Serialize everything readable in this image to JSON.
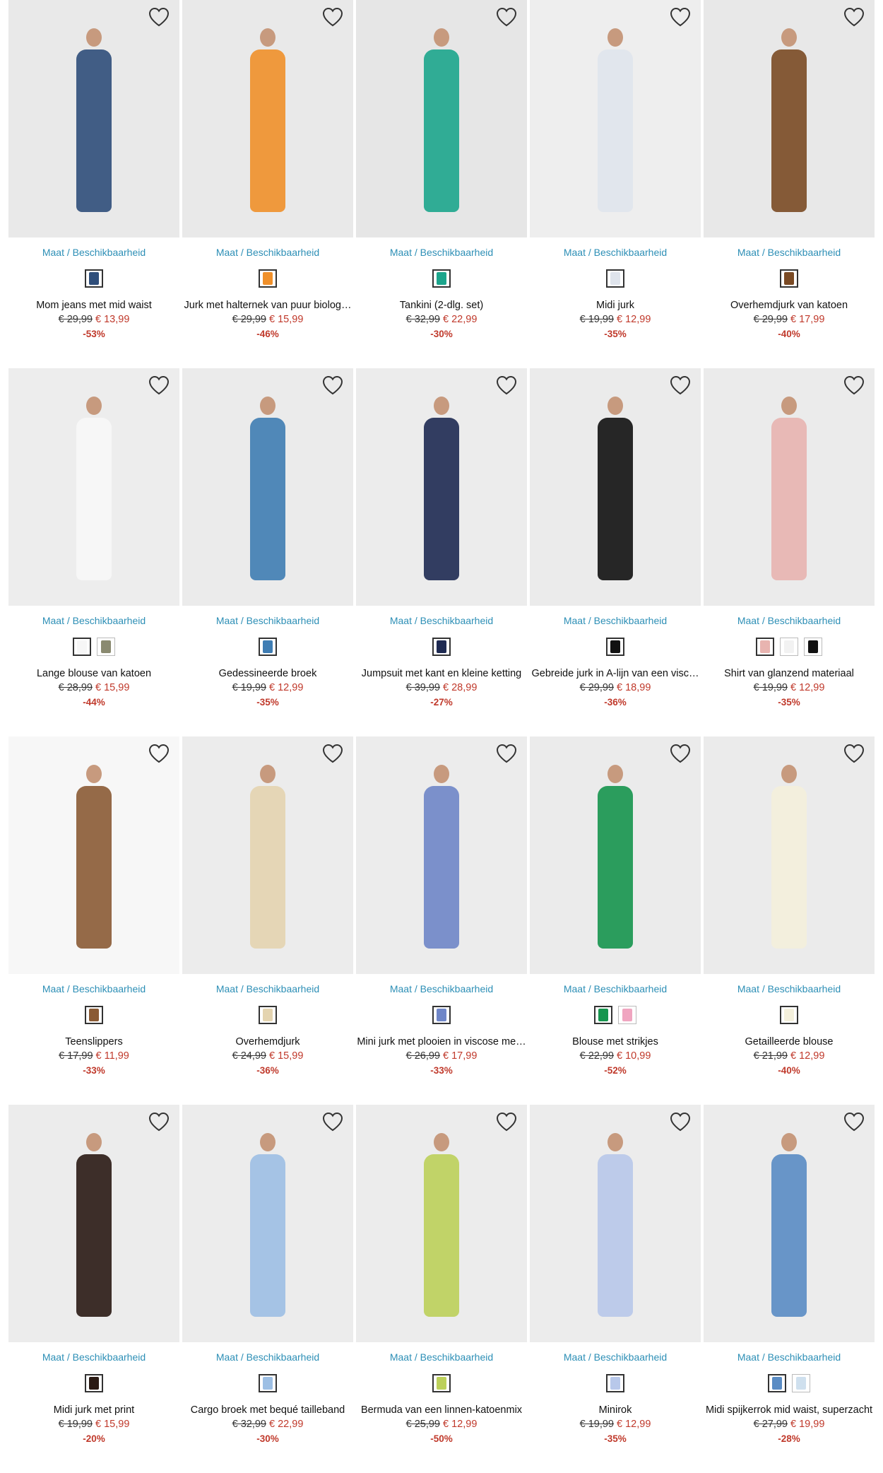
{
  "maat_label": "Maat / Beschikbaarheid",
  "products": [
    {
      "title": "Mom jeans met mid waist",
      "old_price": "€ 29,99",
      "new_price": "€ 13,99",
      "discount": "-53%",
      "bg": "#e9e9e9",
      "colors": [
        "#2f4e7a"
      ],
      "sel": 0
    },
    {
      "title": "Jurk met halternek van puur biolog…",
      "old_price": "€ 29,99",
      "new_price": "€ 15,99",
      "discount": "-46%",
      "bg": "#e9e9e9",
      "colors": [
        "#f0902a"
      ],
      "sel": 0
    },
    {
      "title": "Tankini (2-dlg. set)",
      "old_price": "€ 32,99",
      "new_price": "€ 22,99",
      "discount": "-30%",
      "bg": "#e6e6e6",
      "colors": [
        "#1ca58c"
      ],
      "sel": 0
    },
    {
      "title": "Midi jurk",
      "old_price": "€ 19,99",
      "new_price": "€ 12,99",
      "discount": "-35%",
      "bg": "#eeeeee",
      "colors": [
        "#dfe4ec"
      ],
      "sel": 0
    },
    {
      "title": "Overhemdjurk van katoen",
      "old_price": "€ 29,99",
      "new_price": "€ 17,99",
      "discount": "-40%",
      "bg": "#e8e8e8",
      "colors": [
        "#7a4a24"
      ],
      "sel": 0
    },
    {
      "title": "Lange blouse van katoen",
      "old_price": "€ 28,99",
      "new_price": "€ 15,99",
      "discount": "-44%",
      "bg": "#ededed",
      "colors": [
        "#f7f7f7",
        "#8a8a70"
      ],
      "sel": 0
    },
    {
      "title": "Gedessineerde broek",
      "old_price": "€ 19,99",
      "new_price": "€ 12,99",
      "discount": "-35%",
      "bg": "#ebebeb",
      "colors": [
        "#3f7db3"
      ],
      "sel": 0
    },
    {
      "title": "Jumpsuit met kant en kleine ketting",
      "old_price": "€ 39,99",
      "new_price": "€ 28,99",
      "discount": "-27%",
      "bg": "#ececec",
      "colors": [
        "#1e2a52"
      ],
      "sel": 0
    },
    {
      "title": "Gebreide jurk in A-lijn van een visc…",
      "old_price": "€ 29,99",
      "new_price": "€ 18,99",
      "discount": "-36%",
      "bg": "#ebebeb",
      "colors": [
        "#111111"
      ],
      "sel": 0
    },
    {
      "title": "Shirt van glanzend materiaal",
      "old_price": "€ 19,99",
      "new_price": "€ 12,99",
      "discount": "-35%",
      "bg": "#ebebeb",
      "colors": [
        "#e8b4b0",
        "#f2f2f2",
        "#111111"
      ],
      "sel": 0
    },
    {
      "title": "Teenslippers",
      "old_price": "€ 17,99",
      "new_price": "€ 11,99",
      "discount": "-33%",
      "bg": "#f7f7f7",
      "colors": [
        "#8a5a34"
      ],
      "sel": 0
    },
    {
      "title": "Overhemdjurk",
      "old_price": "€ 24,99",
      "new_price": "€ 15,99",
      "discount": "-36%",
      "bg": "#ececec",
      "colors": [
        "#e4d4b0"
      ],
      "sel": 0
    },
    {
      "title": "Mini jurk met plooien in viscose me…",
      "old_price": "€ 26,99",
      "new_price": "€ 17,99",
      "discount": "-33%",
      "bg": "#ececec",
      "colors": [
        "#6f86c8"
      ],
      "sel": 0
    },
    {
      "title": "Blouse met strikjes",
      "old_price": "€ 22,99",
      "new_price": "€ 10,99",
      "discount": "-52%",
      "bg": "#ebebeb",
      "colors": [
        "#16954e",
        "#f0a5c0"
      ],
      "sel": 0
    },
    {
      "title": "Getailleerde blouse",
      "old_price": "€ 21,99",
      "new_price": "€ 12,99",
      "discount": "-40%",
      "bg": "#ebebeb",
      "colors": [
        "#f4f0dc"
      ],
      "sel": 0
    },
    {
      "title": "Midi jurk met print",
      "old_price": "€ 19,99",
      "new_price": "€ 15,99",
      "discount": "-20%",
      "bg": "#ececec",
      "colors": [
        "#2a1a14"
      ],
      "sel": 0
    },
    {
      "title": "Cargo broek met bequé tailleband",
      "old_price": "€ 32,99",
      "new_price": "€ 22,99",
      "discount": "-30%",
      "bg": "#ececec",
      "colors": [
        "#9dbfe4"
      ],
      "sel": 0
    },
    {
      "title": "Bermuda van een linnen-katoenmix",
      "old_price": "€ 25,99",
      "new_price": "€ 12,99",
      "discount": "-50%",
      "bg": "#ececec",
      "colors": [
        "#bcd05a"
      ],
      "sel": 0
    },
    {
      "title": "Minirok",
      "old_price": "€ 19,99",
      "new_price": "€ 12,99",
      "discount": "-35%",
      "bg": "#ececec",
      "colors": [
        "#b8c8ea"
      ],
      "sel": 0
    },
    {
      "title": "Midi spijkerrok mid waist, superzacht",
      "old_price": "€ 27,99",
      "new_price": "€ 19,99",
      "discount": "-28%",
      "bg": "#ececec",
      "colors": [
        "#5a8cc4",
        "#cfe0ee"
      ],
      "sel": 0
    }
  ]
}
